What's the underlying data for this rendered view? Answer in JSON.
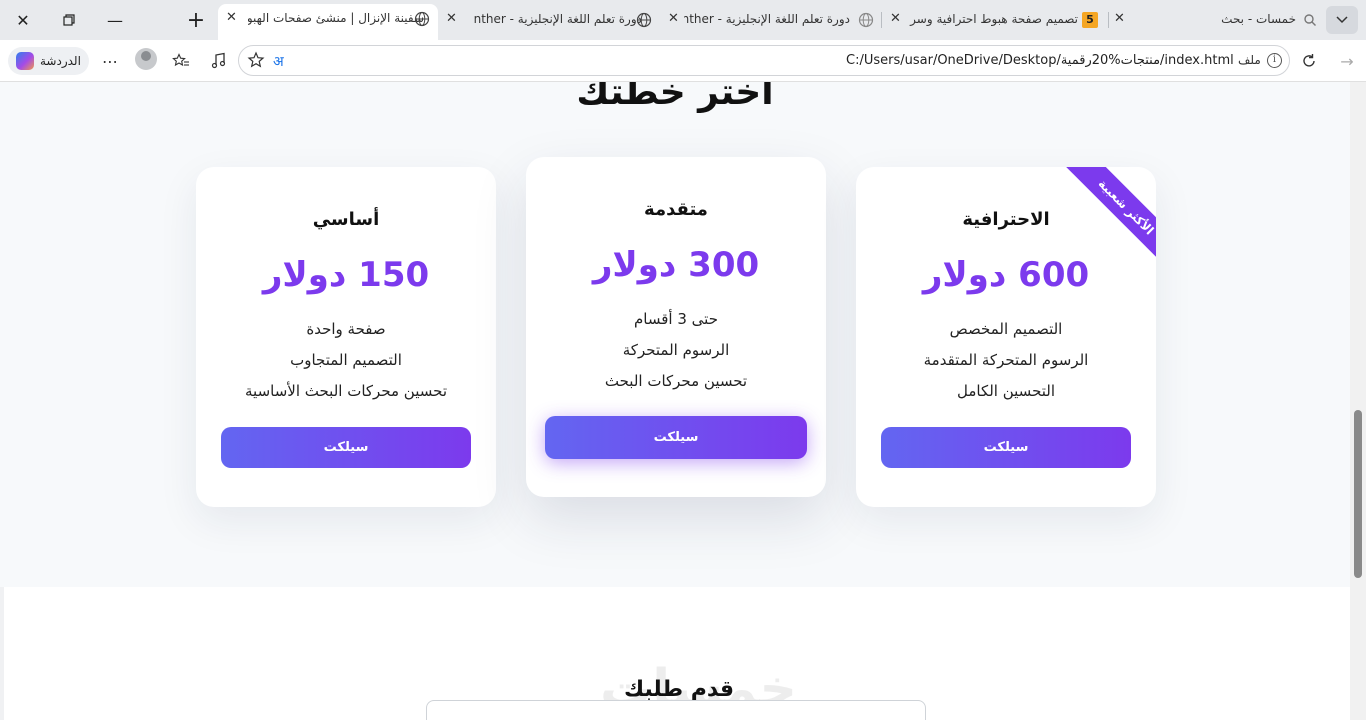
{
  "browser": {
    "tabs": [
      {
        "label": "خمسات - بحث",
        "favicon": "search-icon"
      },
      {
        "label": "تصميم صفحة هبوط احترافية وسر",
        "favicon": "khamsat-icon"
      },
      {
        "label": "دورة تعلم اللغة الإنجليزية - nther",
        "favicon": "globe-icon"
      },
      {
        "label": "دورة تعلم اللغة الإنجليزية - nther",
        "favicon": "globe-icon"
      },
      {
        "label": "سفينة الإنزال | منشئ صفحات الهبوط",
        "favicon": "globe-icon",
        "active": true
      }
    ],
    "file_label": "ملف",
    "url": "C:/Users/usar/OneDrive/Desktop/منتجات%20رقمية/index.html",
    "read_aloud_label": "अ",
    "chat_label": "الدردشة"
  },
  "page": {
    "pricing_title": "اختر خطتك",
    "plans": [
      {
        "name": "الاحترافية",
        "price": "600 دولار",
        "features": [
          "التصميم المخصص",
          "الرسوم المتحركة المتقدمة",
          "التحسين الكامل"
        ],
        "button": "سيلكت",
        "badge": "الأكثر شعبية"
      },
      {
        "name": "متقدمة",
        "price": "300 دولار",
        "features": [
          "حتى 3 أقسام",
          "الرسوم المتحركة",
          "تحسين محركات البحث"
        ],
        "button": "سيلكت"
      },
      {
        "name": "أساسي",
        "price": "150 دولار",
        "features": [
          "صفحة واحدة",
          "التصميم المتجاوب",
          "تحسين محركات البحث الأساسية"
        ],
        "button": "سيلكت"
      }
    ],
    "form_title": "قدم طلبك",
    "watermark": "خمسات"
  },
  "colors": {
    "accent": "#7c3aed",
    "accent_secondary": "#6366f1"
  }
}
